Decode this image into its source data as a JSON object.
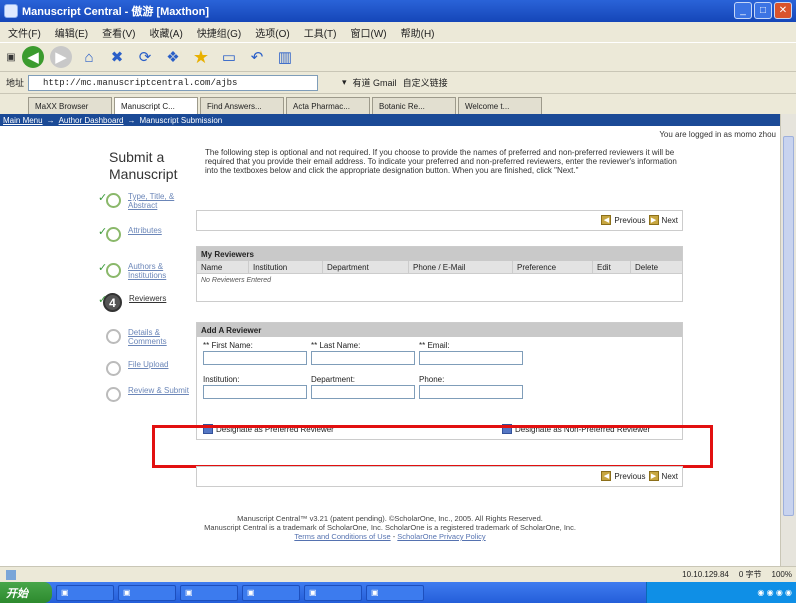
{
  "window": {
    "title": "Manuscript Central - 傲游 [Maxthon]"
  },
  "menu": [
    "文件(F)",
    "编辑(E)",
    "查看(V)",
    "收藏(A)",
    "快捷组(G)",
    "选项(O)",
    "工具(T)",
    "窗口(W)",
    "帮助(H)"
  ],
  "address": {
    "label": "地址",
    "url": "http://mc.manuscriptcentral.com/ajbs",
    "search_label": "有道 Gmail",
    "extra_label": "自定义链接"
  },
  "tabs": [
    "MaXX Browser",
    "Manuscript C...",
    "Find Answers...",
    "Acta Pharmac...",
    "Botanic Re...",
    "Welcome t..."
  ],
  "breadcrumb": {
    "main_menu": "Main Menu",
    "sep1": "→",
    "author_dashboard": "Author Dashboard",
    "sep2": "→",
    "current": "Manuscript Submission"
  },
  "logged_in": "You are logged in as momo zhou",
  "heading": "Submit a Manuscript",
  "intro": "The following step is optional and not required. If you choose to provide the names of preferred and non-preferred reviewers it will be required that you provide their email address. To indicate your preferred and non-preferred reviewers, enter the reviewer's information into the textboxes below and click the appropriate designation button. When you are finished, click \"Next.\"",
  "steps": [
    {
      "label": "Type, Title, & Abstract"
    },
    {
      "label": "Attributes"
    },
    {
      "label": "Authors & Institutions"
    },
    {
      "number": "4",
      "label": "Reviewers"
    },
    {
      "label": "Details & Comments"
    },
    {
      "label": "File Upload"
    },
    {
      "label": "Review & Submit"
    }
  ],
  "nav": {
    "previous": "Previous",
    "next": "Next",
    "prev_arrow": "◀",
    "next_arrow": "▶"
  },
  "my_reviewers": {
    "title": "My Reviewers",
    "columns": [
      "Name",
      "Institution",
      "Department",
      "Phone / E-Mail",
      "Preference",
      "Edit",
      "Delete"
    ],
    "empty": "No Reviewers Entered"
  },
  "add_reviewer": {
    "title": "Add A Reviewer",
    "first_name": "** First Name:",
    "last_name": "** Last Name:",
    "email": "** Email:",
    "institution": "Institution:",
    "department": "Department:",
    "phone": "Phone:",
    "designate_preferred": "Designate as Preferred Reviewer",
    "designate_nonpreferred": "Designate as Non-Preferred Reviewer"
  },
  "footer": {
    "line1": "Manuscript Central™ v3.21 (patent pending). ©ScholarOne, Inc., 2005. All Rights Reserved.",
    "line2": "Manuscript Central is a trademark of ScholarOne, Inc. ScholarOne is a registered trademark of ScholarOne, Inc.",
    "terms": "Terms and Conditions of Use",
    "sep": " - ",
    "privacy": "ScholarOne Privacy Policy"
  },
  "status": {
    "ip": "10.10.129.84",
    "speed": "0 字节",
    "zoom": "100%"
  },
  "taskbar": {
    "start": "开始"
  },
  "colors": {
    "accent_red": "#e21010",
    "crumb_bg": "#1b4a96",
    "section_head": "#c9c9c9"
  }
}
